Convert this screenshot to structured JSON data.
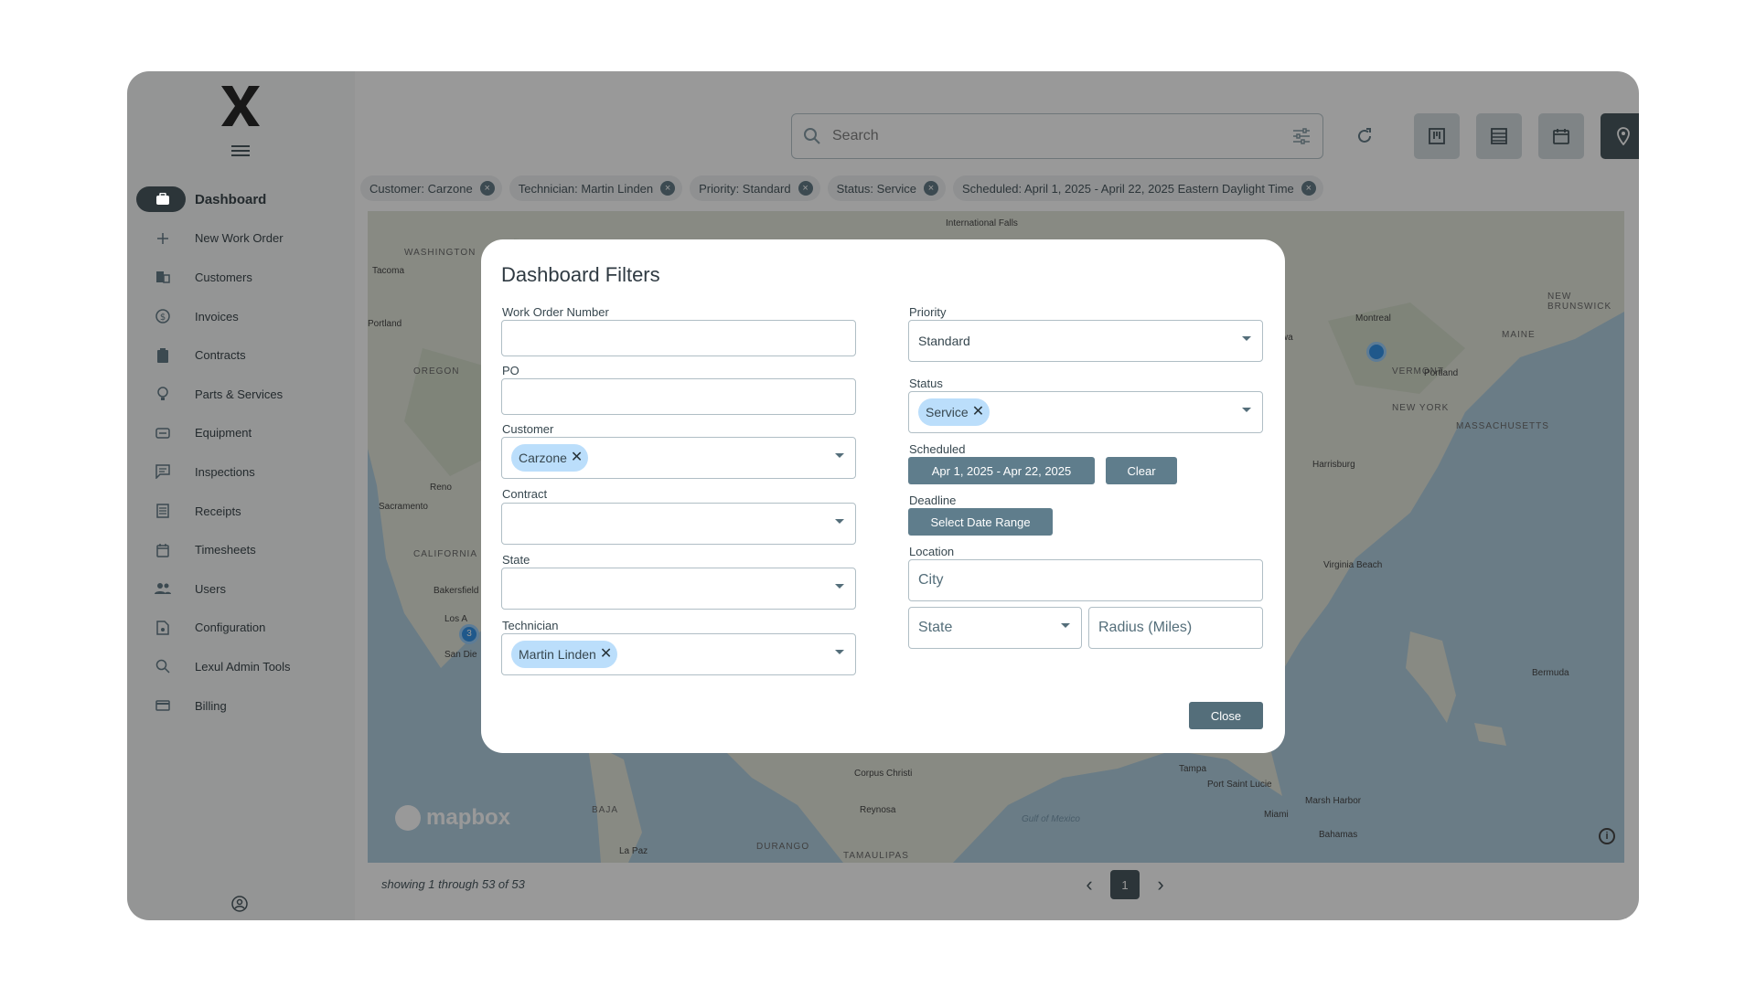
{
  "sidebar": {
    "items": [
      {
        "label": "Dashboard",
        "icon": "briefcase-icon"
      },
      {
        "label": "New Work Order",
        "icon": "plus-icon"
      },
      {
        "label": "Customers",
        "icon": "building-icon"
      },
      {
        "label": "Invoices",
        "icon": "dollar-icon"
      },
      {
        "label": "Contracts",
        "icon": "clipboard-icon"
      },
      {
        "label": "Parts & Services",
        "icon": "lightbulb-icon"
      },
      {
        "label": "Equipment",
        "icon": "equipment-icon"
      },
      {
        "label": "Inspections",
        "icon": "comment-icon"
      },
      {
        "label": "Receipts",
        "icon": "receipt-icon"
      },
      {
        "label": "Timesheets",
        "icon": "calendar-icon"
      },
      {
        "label": "Users",
        "icon": "users-icon"
      },
      {
        "label": "Configuration",
        "icon": "file-cog-icon"
      },
      {
        "label": "Lexul Admin Tools",
        "icon": "zoom-icon"
      },
      {
        "label": "Billing",
        "icon": "credit-card-icon"
      }
    ]
  },
  "header": {
    "search_placeholder": "Search"
  },
  "chips": [
    {
      "label": "Customer:  Carzone"
    },
    {
      "label": "Technician:  Martin Linden"
    },
    {
      "label": "Priority: Standard"
    },
    {
      "label": "Status:  Service"
    },
    {
      "label": "Scheduled: April 1, 2025 - April 22, 2025 Eastern Daylight Time"
    }
  ],
  "map": {
    "attribution": "mapbox",
    "labels": [
      "WASHINGTON",
      "OREGON",
      "CALIFORNIA",
      "NEW BRUNSWICK",
      "MAINE",
      "VERMONT",
      "NEW YORK",
      "MASSACHUSETTS",
      "BAJA",
      "DURANGO",
      "TAMAULIPAS"
    ],
    "cities": [
      "Tacoma",
      "Portland",
      "Reno",
      "Sacramento",
      "Bakersfield",
      "Los A",
      "San Die",
      "Montreal",
      "Ottawa",
      "Portland",
      "Harrisburg",
      "Virginia Beach",
      "Bermuda",
      "Tampa",
      "Port Saint Lucie",
      "Miami",
      "Bahamas",
      "Corpus Christi",
      "Reynosa",
      "La Paz",
      "International Falls",
      "Gulf of Mexico",
      "Marsh Harbor"
    ],
    "cluster_count": "3"
  },
  "footer": {
    "showing_text": "showing 1 through 53 of 53",
    "page": "1"
  },
  "modal": {
    "title": "Dashboard Filters",
    "work_order_label": "Work Order Number",
    "po_label": "PO",
    "customer_label": "Customer",
    "customer_tag": "Carzone",
    "contract_label": "Contract",
    "state_label": "State",
    "technician_label": "Technician",
    "technician_tag": "Martin Linden",
    "priority_label": "Priority",
    "priority_value": "Standard",
    "status_label": "Status",
    "status_tag": "Service",
    "scheduled_label": "Scheduled",
    "scheduled_range": "Apr 1, 2025 - Apr 22, 2025",
    "clear_label": "Clear",
    "deadline_label": "Deadline",
    "deadline_button": "Select Date Range",
    "location_label": "Location",
    "city_placeholder": "City",
    "state_placeholder": "State",
    "radius_placeholder": "Radius (Miles)",
    "close_label": "Close"
  }
}
